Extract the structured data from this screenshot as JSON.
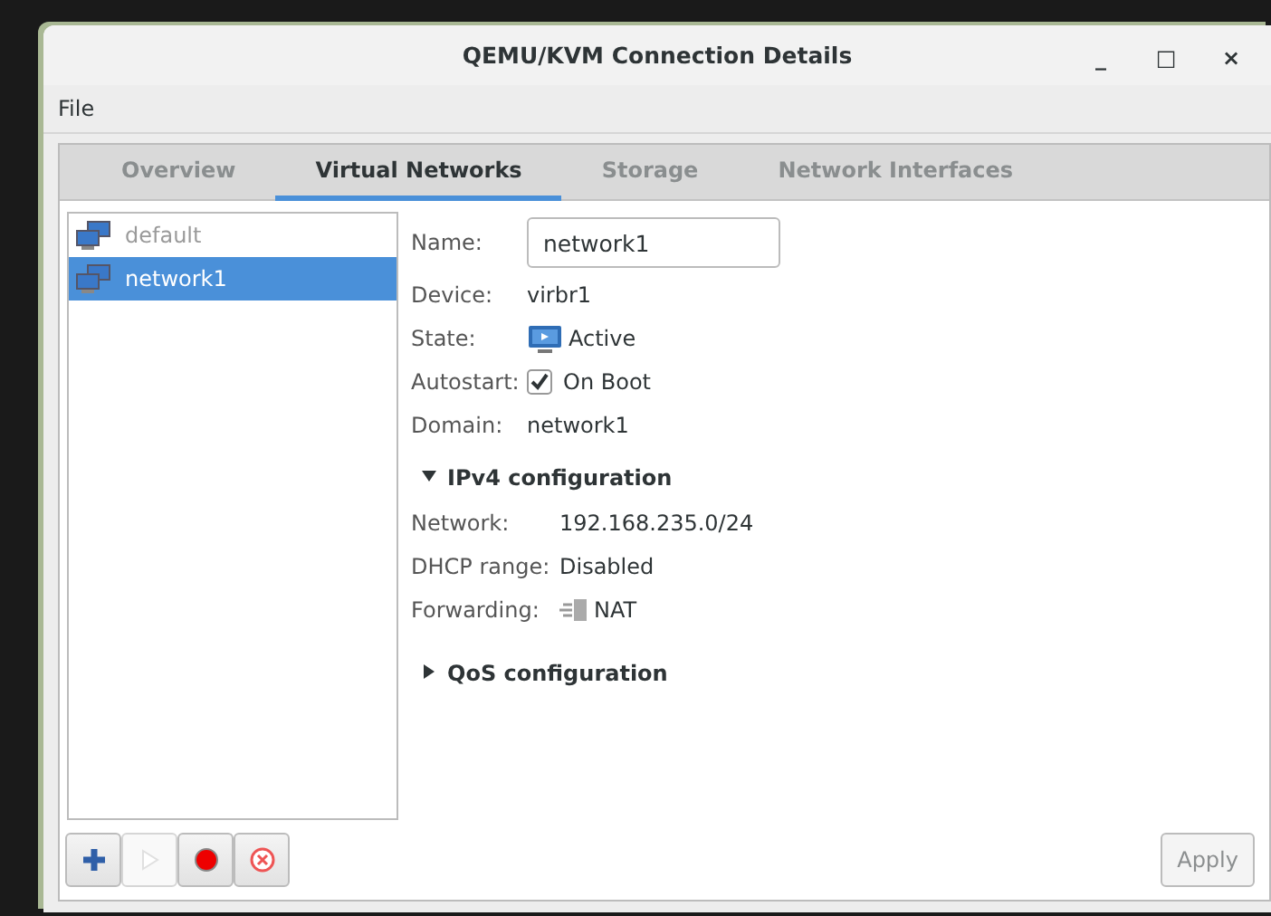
{
  "window": {
    "title": "QEMU/KVM Connection Details",
    "controls": [
      "_",
      "□",
      "×"
    ]
  },
  "menu": [
    "File"
  ],
  "tabs": [
    {
      "label": "Overview",
      "selected": false
    },
    {
      "label": "Virtual Networks",
      "selected": true
    },
    {
      "label": "Storage",
      "selected": false
    },
    {
      "label": "Network Interfaces",
      "selected": false
    }
  ],
  "networks": [
    {
      "name": "default",
      "active": false,
      "selected": false
    },
    {
      "name": "network1",
      "active": true,
      "selected": true
    }
  ],
  "details": {
    "name_label": "Name:",
    "name_value": "network1",
    "fields": [
      {
        "label": "Device:",
        "value": "virbr1",
        "kind": "text"
      },
      {
        "label": "State:",
        "value": "Active",
        "kind": "state"
      },
      {
        "label": "Autostart:",
        "value": "On Boot",
        "kind": "check",
        "checked": true
      },
      {
        "label": "Domain:",
        "value": "network1",
        "kind": "text"
      }
    ],
    "ipv4": {
      "title": "IPv4 configuration",
      "expanded": true,
      "fields": [
        {
          "label": "Network:",
          "value": "192.168.235.0/24",
          "kind": "text"
        },
        {
          "label": "DHCP range:",
          "value": "Disabled",
          "kind": "text"
        },
        {
          "label": "Forwarding:",
          "value": "NAT",
          "kind": "forward"
        }
      ]
    },
    "qos": {
      "title": "QoS configuration",
      "expanded": false
    }
  },
  "toolbar": [
    {
      "kind": "add",
      "disabled": false
    },
    {
      "kind": "start",
      "disabled": true
    },
    {
      "kind": "stop",
      "disabled": false
    },
    {
      "kind": "delete",
      "disabled": false
    }
  ],
  "apply": {
    "label": "Apply",
    "disabled": true
  }
}
